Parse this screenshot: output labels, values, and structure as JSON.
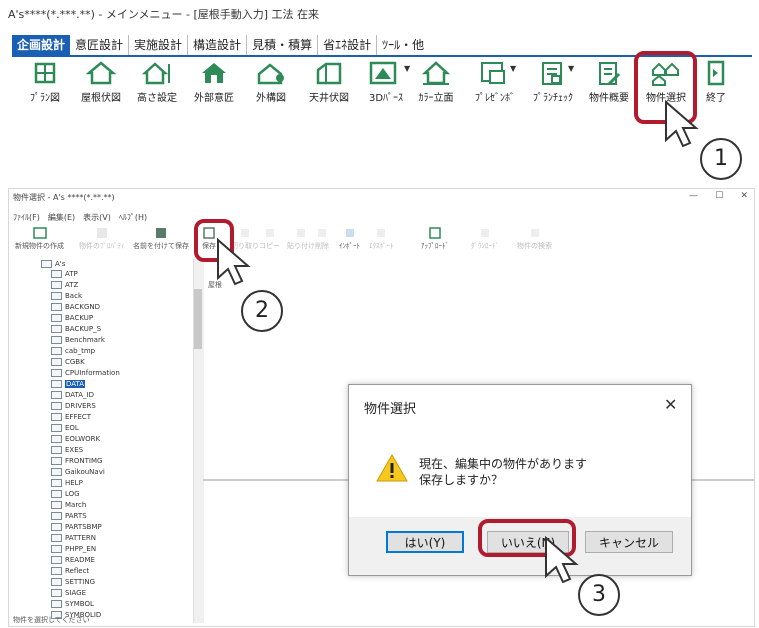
{
  "top_window": {
    "title": "A's****(*.***.**) - メインメニュー - [屋根手動入力] 工法 在来",
    "tabs": [
      "企画設計",
      "意匠設計",
      "実施設計",
      "構造設計",
      "見積・積算",
      "省ｴﾈ設計",
      "ﾂｰﾙ・他"
    ],
    "active_tab": "企画設計",
    "tools": [
      {
        "label": "ﾌﾟﾗﾝ図",
        "icon": "plan-drawing-icon"
      },
      {
        "label": "屋根伏図",
        "icon": "roof-plan-icon"
      },
      {
        "label": "高さ設定",
        "icon": "height-setting-icon"
      },
      {
        "label": "外部意匠",
        "icon": "exterior-design-icon"
      },
      {
        "label": "外構図",
        "icon": "exterior-structure-icon"
      },
      {
        "label": "天井伏図",
        "icon": "ceiling-plan-icon"
      },
      {
        "label": "3Dﾊﾟｰｽ",
        "icon": "3d-perspective-icon"
      },
      {
        "label": "ｶﾗｰ立面",
        "icon": "color-elevation-icon"
      },
      {
        "label": "ﾌﾟﾚｾﾞﾝﾎﾞ",
        "icon": "presentation-board-icon"
      },
      {
        "label": "ﾌﾟﾗﾝﾁｪｯｸ",
        "icon": "plan-check-icon"
      },
      {
        "label": "物件概要",
        "icon": "property-summary-icon"
      },
      {
        "label": "物件選択",
        "icon": "property-select-icon"
      },
      {
        "label": "終了",
        "icon": "exit-icon"
      }
    ]
  },
  "property_window": {
    "title": "物件選択 - A's ****(*.**.**)",
    "menu": "ﾌｧｲﾙ(F)　編集(E)　表示(V)　ﾍﾙﾌﾟ(H)",
    "toolbar": [
      "新規物件の作成",
      "物件のﾌﾟﾛﾊﾟﾃｨ",
      "名前を付けて保存",
      "保存",
      "切り取り",
      "コピー",
      "貼り付け",
      "削除",
      "ｲﾝﾎﾟｰﾄ",
      "ｴｸｽﾎﾟｰﾄ",
      "ｱｯﾌﾟﾛｰﾄﾞ",
      "ﾀﾞｳﾝﾛｰﾄﾞ",
      "物件の検索"
    ],
    "tree_root": "A's",
    "tree_items": [
      "ATP",
      "ATZ",
      "Back",
      "BACKGND",
      "BACKUP",
      "BACKUP_S",
      "Benchmark",
      "cab_tmp",
      "CGBK",
      "CPUInformation",
      "DATA",
      "DATA_ID",
      "DRIVERS",
      "EFFECT",
      "EOL",
      "EOLWORK",
      "EXES",
      "FRONTIMG",
      "GaikouNavi",
      "HELP",
      "LOG",
      "March",
      "PARTS",
      "PARTSBMP",
      "PATTERN",
      "PHPP_EN",
      "README",
      "Reflect",
      "SETTING",
      "SIAGE",
      "SYMBOL",
      "SYMBOLID"
    ],
    "selected_item": "DATA",
    "right_label": "屋根",
    "status": "物件を選択してください"
  },
  "dialog": {
    "title": "物件選択",
    "message_line1": "現在、編集中の物件があります",
    "message_line2": "保存しますか？",
    "buttons": {
      "yes": "はい(Y)",
      "no": "いいえ(N)",
      "cancel": "キャンセル"
    }
  },
  "callouts": [
    "1",
    "2",
    "3"
  ],
  "colors": {
    "accent_blue": "#1a5fb4",
    "highlight_red": "#b01c2e",
    "icon_green": "#2e8b57"
  }
}
